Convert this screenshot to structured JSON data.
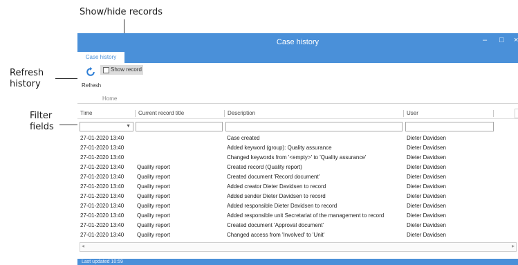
{
  "callouts": {
    "show_hide": "Show/hide records",
    "refresh_line1": "Refresh",
    "refresh_line2": "history",
    "filter_line1": "Filter",
    "filter_line2": "fields"
  },
  "window": {
    "title": "Case history",
    "minimize": "–",
    "maximize": "□",
    "close": "×"
  },
  "ribbon": {
    "tab": "Case history",
    "refresh_label": "Refresh",
    "show_record_label": "Show record",
    "group_label": "Home",
    "refresh_icon": "refresh-icon"
  },
  "table": {
    "columns": [
      "Time",
      "Current record title",
      "Description",
      "User"
    ],
    "rows": [
      [
        "27-01-2020 13:40",
        "",
        "Case created",
        "Dieter Davidsen"
      ],
      [
        "27-01-2020 13:40",
        "",
        "Added keyword (group): Quality assurance",
        "Dieter Davidsen"
      ],
      [
        "27-01-2020 13:40",
        "",
        "Changed keywords from '<empty>' to 'Quality assurance'",
        "Dieter Davidsen"
      ],
      [
        "27-01-2020 13:40",
        "Quality report",
        "Created record (Quality report)",
        "Dieter Davidsen"
      ],
      [
        "27-01-2020 13:40",
        "Quality report",
        "Created document 'Record document'",
        "Dieter Davidsen"
      ],
      [
        "27-01-2020 13:40",
        "Quality report",
        "Added creator Dieter Davidsen to record",
        "Dieter Davidsen"
      ],
      [
        "27-01-2020 13:40",
        "Quality report",
        "Added sender Dieter Davidsen to record",
        "Dieter Davidsen"
      ],
      [
        "27-01-2020 13:40",
        "Quality report",
        "Added responsible Dieter Davidsen to record",
        "Dieter Davidsen"
      ],
      [
        "27-01-2020 13:40",
        "Quality report",
        "Added responsible unit Secretariat of the management to record",
        "Dieter Davidsen"
      ],
      [
        "27-01-2020 13:40",
        "Quality report",
        "Created document 'Approval document'",
        "Dieter Davidsen"
      ],
      [
        "27-01-2020 13:40",
        "Quality report",
        "Changed access from 'Involved' to 'Unit'",
        "Dieter Davidsen"
      ]
    ]
  },
  "status": {
    "text": "Last updated 10:59"
  },
  "colors": {
    "accent": "#4a90d9"
  }
}
